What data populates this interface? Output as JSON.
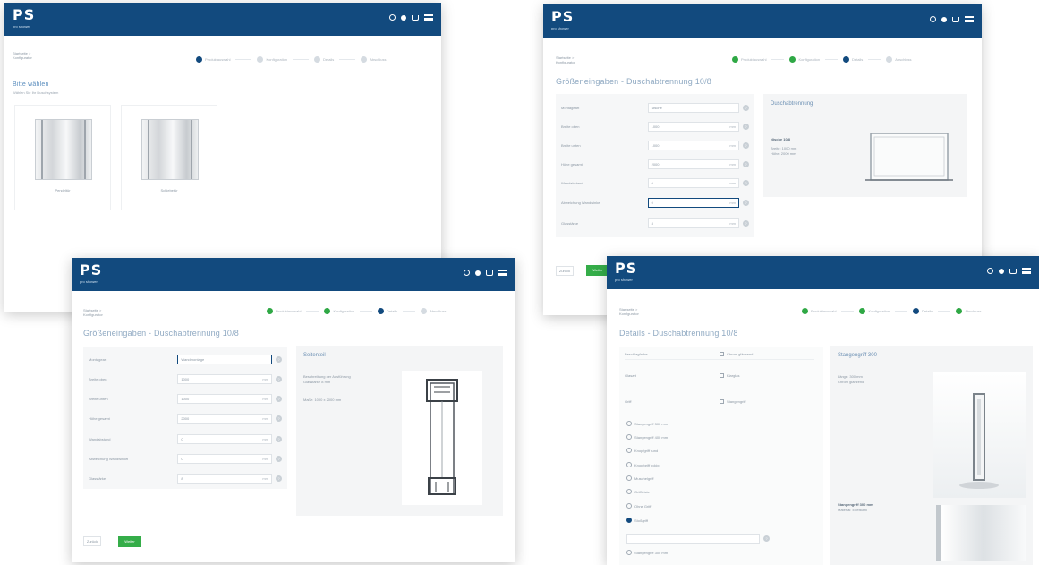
{
  "brand": {
    "logo": "PS",
    "logo_sub": "pro shower",
    "header_color": "#124a7e",
    "accent": "#35ad49"
  },
  "header_icons": [
    "search-icon",
    "user-icon",
    "cart-icon",
    "menu-icon"
  ],
  "steps": [
    "Produktauswahl",
    "Konfiguration",
    "Details",
    "Abschluss"
  ],
  "window1": {
    "crumb": "Startseite > Konfigurator",
    "title": "Bitte wählen",
    "subtitle": "Wählen Sie Ihr Duschsystem",
    "cards": [
      {
        "label": "Pendeltür"
      },
      {
        "label": "Schiebetür"
      }
    ]
  },
  "window2": {
    "crumb": "Startseite > Konfigurator",
    "title": "Größeneingaben - Duschabtrennung 10/8",
    "fields": [
      {
        "label": "Montageart",
        "value": "Nische",
        "unit": ""
      },
      {
        "label": "Breite oben",
        "value": "1000",
        "unit": "mm"
      },
      {
        "label": "Breite unten",
        "value": "1000",
        "unit": "mm"
      },
      {
        "label": "Höhe gesamt",
        "value": "2000",
        "unit": "mm"
      },
      {
        "label": "Wandabstand",
        "value": "0",
        "unit": "mm"
      },
      {
        "label": "Abweichung Wandwinkel",
        "value": "0",
        "unit": "mm"
      },
      {
        "label": "Glasstärke",
        "value": "8",
        "unit": "mm"
      }
    ],
    "panel_title": "Duschabtrennung",
    "panel_line1": "Nische 10/8",
    "panel_line2": "Breite: 1000 mm",
    "panel_line3": "Höhe: 2000 mm",
    "back": "Zurück",
    "next": "Weiter"
  },
  "window3": {
    "crumb": "Startseite > Konfigurator",
    "title": "Größeneingaben - Duschabtrennung 10/8",
    "fields": [
      {
        "label": "Montageart",
        "value": "Wandmontage",
        "unit": ""
      },
      {
        "label": "Breite oben",
        "value": "1000",
        "unit": "mm"
      },
      {
        "label": "Breite unten",
        "value": "1000",
        "unit": "mm"
      },
      {
        "label": "Höhe gesamt",
        "value": "2000",
        "unit": "mm"
      },
      {
        "label": "Wandabstand",
        "value": "0",
        "unit": "mm"
      },
      {
        "label": "Abweichung Wandwinkel",
        "value": "0",
        "unit": "mm"
      },
      {
        "label": "Glasstärke",
        "value": "8",
        "unit": "mm"
      }
    ],
    "panel_title": "Seitenteil",
    "panel_line1": "Beschreibung der Ausführung",
    "panel_line2": "Glasstärke 8 mm",
    "panel_line3": "Maße: 1000 x 2000 mm",
    "back": "Zurück",
    "next": "Weiter"
  },
  "window4": {
    "crumb": "Startseite > Konfigurator",
    "title": "Details - Duschabtrennung 10/8",
    "options": [
      "Beschlagfarbe",
      "Glasart",
      "Griff"
    ],
    "option_values": [
      "Chrom glänzend",
      "Klarglas",
      "Stangengriff"
    ],
    "radios": [
      "Stangengriff 300 mm",
      "Stangengriff 400 mm",
      "Knopfgriff rund",
      "Knopfgriff eckig",
      "Muschelgriff",
      "Griffleiste",
      "Ohne Griff",
      "Stoßgriff"
    ],
    "panel_title": "Stangengriff 300",
    "panel_line1": "Länge: 300 mm",
    "panel_line2": "Chrom glänzend",
    "panel_product": "Stangengriff 300 mm",
    "panel_product_sub": "Material: Edelstahl"
  }
}
